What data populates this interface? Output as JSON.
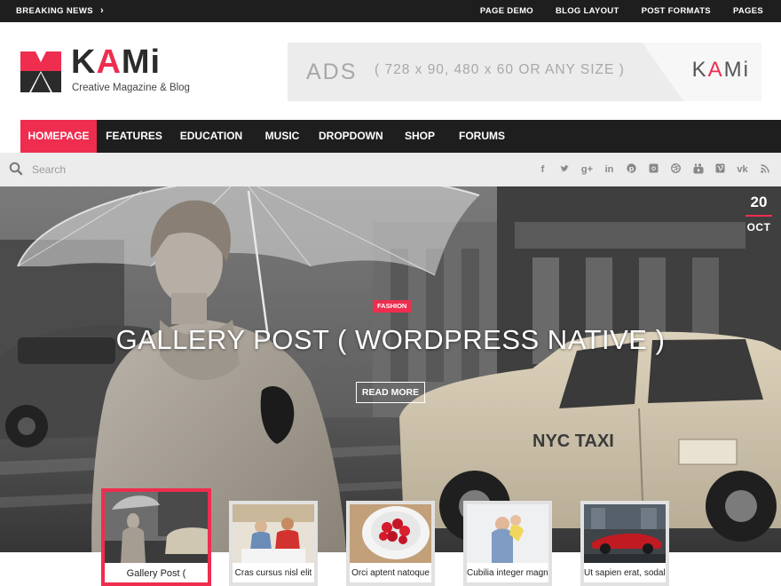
{
  "topbar": {
    "breaking_label": "BREAKING NEWS",
    "menu": [
      "PAGE DEMO",
      "BLOG LAYOUT",
      "POST FORMATS",
      "PAGES"
    ]
  },
  "header": {
    "logo_k": "K",
    "logo_a": "A",
    "logo_mi": "Mi",
    "tagline": "Creative Magazine & Blog",
    "ads": {
      "label": "ADS",
      "sizes": "( 728 x 90,  480 x 60  OR ANY SIZE )",
      "brand_k": "K",
      "brand_a": "A",
      "brand_mi": "Mi"
    }
  },
  "nav": {
    "items": [
      "HOMEPAGE",
      "FEATURES",
      "EDUCATION",
      "MUSIC",
      "DROPDOWN",
      "SHOP",
      "FORUMS"
    ],
    "active": "HOMEPAGE"
  },
  "search": {
    "placeholder": "Search"
  },
  "social_icons": [
    "facebook-icon",
    "twitter-icon",
    "google-plus-icon",
    "linkedin-icon",
    "pinterest-icon",
    "instagram-icon",
    "dribbble-icon",
    "youtube-icon",
    "vimeo-icon",
    "vk-icon",
    "rss-icon"
  ],
  "hero": {
    "date_day": "20",
    "date_month": "OCT",
    "category": "FASHION",
    "title": "GALLERY POST ( WORDPRESS NATIVE )",
    "read_more": "READ MORE",
    "taxi_text": "NYC TAXI"
  },
  "thumbnails": [
    {
      "caption": "Gallery Post (",
      "active": true
    },
    {
      "caption": "Cras cursus nisl elit",
      "active": false
    },
    {
      "caption": "Orci aptent natoque",
      "active": false
    },
    {
      "caption": "Cubilia integer magna",
      "active": false
    },
    {
      "caption": "Ut sapien erat, sodales",
      "active": false
    }
  ],
  "colors": {
    "accent": "#ee2d4f",
    "dark": "#1e1e1e",
    "light_bar": "#ececec"
  }
}
